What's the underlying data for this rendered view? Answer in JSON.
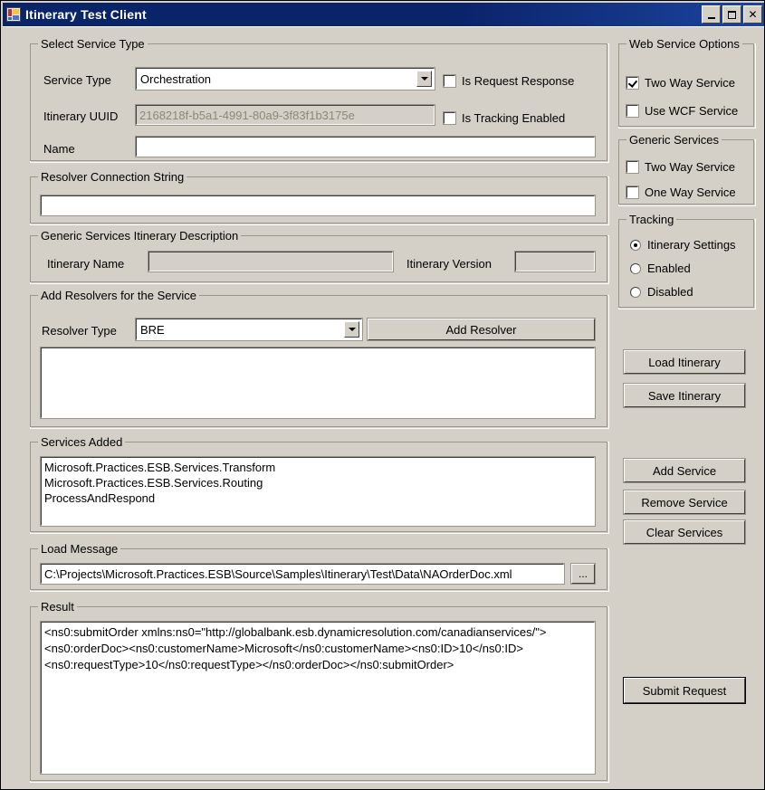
{
  "window": {
    "title": "Itinerary Test Client",
    "icon": "form-icon",
    "minimize_label": "_",
    "maximize_label": "□",
    "close_label": "✕"
  },
  "select_service_type": {
    "legend": "Select Service Type",
    "service_type_label": "Service Type",
    "service_type_value": "Orchestration",
    "itinerary_uuid_label": "Itinerary UUID",
    "itinerary_uuid_value": "2168218f-b5a1-4991-80a9-3f83f1b3175e",
    "name_label": "Name",
    "name_value": "",
    "is_request_response_label": "Is Request Response",
    "is_request_response_checked": false,
    "is_tracking_enabled_label": "Is Tracking Enabled",
    "is_tracking_enabled_checked": false
  },
  "resolver_connection_string": {
    "legend": "Resolver Connection String",
    "value": ""
  },
  "generic_services_itinerary_description": {
    "legend": "Generic Services Itinerary Description",
    "itinerary_name_label": "Itinerary Name",
    "itinerary_name_value": "",
    "itinerary_version_label": "Itinerary Version",
    "itinerary_version_value": ""
  },
  "add_resolvers": {
    "legend": "Add Resolvers for the Service",
    "resolver_type_label": "Resolver Type",
    "resolver_type_value": "BRE",
    "add_resolver_button": "Add Resolver",
    "resolver_list": []
  },
  "services_added": {
    "legend": "Services Added",
    "items": [
      "Microsoft.Practices.ESB.Services.Transform",
      "Microsoft.Practices.ESB.Services.Routing",
      "ProcessAndRespond"
    ]
  },
  "load_message": {
    "legend": "Load Message",
    "path_value": "C:\\Projects\\Microsoft.Practices.ESB\\Source\\Samples\\Itinerary\\Test\\Data\\NAOrderDoc.xml",
    "browse_button": "..."
  },
  "result": {
    "legend": "Result",
    "lines": [
      "<ns0:submitOrder xmlns:ns0=\"http://globalbank.esb.dynamicresolution.com/canadianservices/\">",
      "<ns0:orderDoc><ns0:customerName>Microsoft</ns0:customerName><ns0:ID>10</ns0:ID>",
      "<ns0:requestType>10</ns0:requestType></ns0:orderDoc></ns0:submitOrder>"
    ]
  },
  "web_service_options": {
    "legend": "Web Service Options",
    "two_way_service_label": "Two Way Service",
    "two_way_service_checked": true,
    "use_wcf_service_label": "Use WCF Service",
    "use_wcf_service_checked": false
  },
  "generic_services": {
    "legend": "Generic Services",
    "two_way_service_label": "Two Way Service",
    "two_way_service_checked": false,
    "one_way_service_label": "One Way Service",
    "one_way_service_checked": false
  },
  "tracking": {
    "legend": "Tracking",
    "options": [
      {
        "label": "Itinerary Settings",
        "selected": true
      },
      {
        "label": "Enabled",
        "selected": false
      },
      {
        "label": "Disabled",
        "selected": false
      }
    ]
  },
  "actions": {
    "load_itinerary": "Load Itinerary",
    "save_itinerary": "Save Itinerary",
    "add_service": "Add Service",
    "remove_service": "Remove Service",
    "clear_services": "Clear Services",
    "submit_request": "Submit Request"
  },
  "colors": {
    "window_face": "#d4d0c8",
    "title_bar": "#0a246a",
    "field_bg": "#ffffff",
    "disabled_text": "#8b8878"
  }
}
